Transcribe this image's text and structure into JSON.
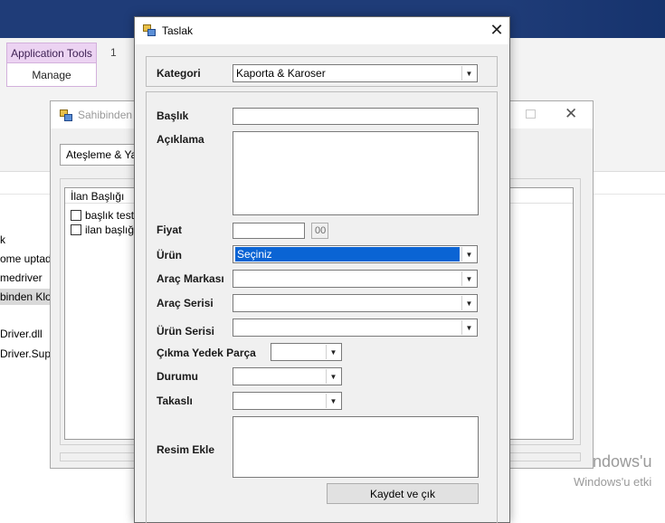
{
  "ribbon": {
    "context_tab": "Application Tools",
    "number": "1",
    "manage_tab": "Manage"
  },
  "file_list": {
    "items": [
      "k",
      "ome uptade",
      "medriver",
      "binden Klo",
      "Driver.dll",
      "Driver.Sup"
    ],
    "selected_index": 3
  },
  "watermark": {
    "line1": "Windows'u",
    "line2": "Windows'u etki"
  },
  "back_window": {
    "title": "Sahibinden",
    "combo_value": "Ateşleme & Yak",
    "list_header": "İlan Başlığı",
    "rows": [
      "başlık test ra",
      "ilan başlığım"
    ]
  },
  "dialog": {
    "title": "Taslak",
    "close_glyph": "✕",
    "kategori": {
      "label": "Kategori",
      "value": "Kaporta & Karoser"
    },
    "baslik": {
      "label": "Başlık",
      "value": ""
    },
    "aciklama": {
      "label": "Açıklama",
      "value": ""
    },
    "fiyat": {
      "label": "Fiyat",
      "value": "",
      "decimal": "00"
    },
    "urun": {
      "label": "Ürün",
      "value": "Seçiniz"
    },
    "arac_markasi": {
      "label": "Araç Markası",
      "value": ""
    },
    "arac_serisi": {
      "label": "Araç Serisi",
      "value": ""
    },
    "urun_serisi": {
      "label": "Ürün Serisi",
      "value": ""
    },
    "cikma": {
      "label": "Çıkma Yedek Parça",
      "value": ""
    },
    "durumu": {
      "label": "Durumu",
      "value": ""
    },
    "takasli": {
      "label": "Takaslı",
      "value": ""
    },
    "resim": {
      "label": "Resim Ekle"
    },
    "save_button": "Kaydet ve çık"
  },
  "icons": {
    "window_icon": "app-window-icon",
    "dropdown_arrow": "▼"
  }
}
